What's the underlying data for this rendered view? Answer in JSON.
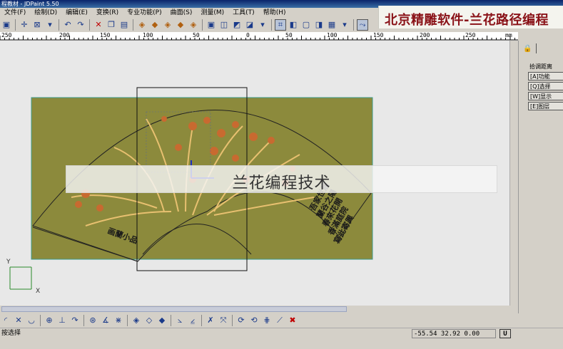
{
  "window": {
    "title": "程教材 - JDPaint 5.50"
  },
  "banner": {
    "text": "北京精雕软件-兰花路径编程"
  },
  "menu": [
    "文件(F)",
    "绘制(D)",
    "编辑(E)",
    "变换(R)",
    "专业功能(P)",
    "曲面(S)",
    "测量(M)",
    "工具(T)",
    "帮助(H)"
  ],
  "ruler": {
    "labels": [
      "250",
      "200",
      "150",
      "100",
      "50",
      "0",
      "50",
      "100",
      "150",
      "200",
      "250",
      "mm"
    ]
  },
  "subtitle": "兰花编程技术",
  "fan_text": {
    "left": "画蘭小品",
    "right_lines": [
      "吾家世居",
      "蘭谷之陽",
      "春來花開",
      "香滿庭院",
      "寫此寄興"
    ]
  },
  "axes": {
    "x": "X",
    "y": "Y"
  },
  "panel": {
    "field_label": "拾调距离",
    "buttons": [
      "[A]功能",
      "[Q]选择",
      "[W]显示",
      "[E]图层"
    ]
  },
  "status": {
    "left": "按选择",
    "coords": "-55.54 32.92 0.00",
    "mode": "U"
  }
}
